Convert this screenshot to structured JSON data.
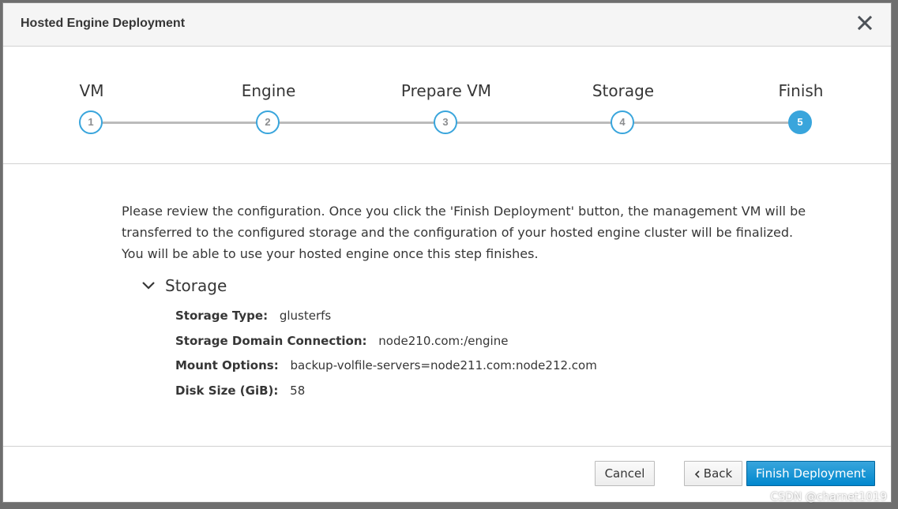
{
  "dialog": {
    "title": "Hosted Engine Deployment",
    "close_icon": "close-icon"
  },
  "wizard": {
    "steps": [
      {
        "label": "VM",
        "number": "1"
      },
      {
        "label": "Engine",
        "number": "2"
      },
      {
        "label": "Prepare VM",
        "number": "3"
      },
      {
        "label": "Storage",
        "number": "4"
      },
      {
        "label": "Finish",
        "number": "5"
      }
    ],
    "active_step": 5,
    "accent_color": "#39a5dc"
  },
  "review": {
    "lines": [
      "Please review the configuration. Once you click the 'Finish Deployment' button, the management VM will be",
      "transferred to the configured storage and the configuration of your hosted engine cluster will be finalized.",
      "You will be able to use your hosted engine once this step finishes."
    ]
  },
  "storage_section": {
    "title": "Storage",
    "toggle_icon": "chevron-down-icon",
    "rows": [
      {
        "key": "Storage Type:",
        "value": "glusterfs"
      },
      {
        "key": "Storage Domain Connection:",
        "value": "node210.com:/engine"
      },
      {
        "key": "Mount Options:",
        "value": "backup-volfile-servers=node211.com:node212.com"
      },
      {
        "key": "Disk Size (GiB):",
        "value": "58"
      }
    ]
  },
  "footer": {
    "cancel_label": "Cancel",
    "back_label": "Back",
    "back_icon": "chevron-left-icon",
    "finish_label": "Finish Deployment"
  },
  "watermark": "CSDN @charnet1019"
}
